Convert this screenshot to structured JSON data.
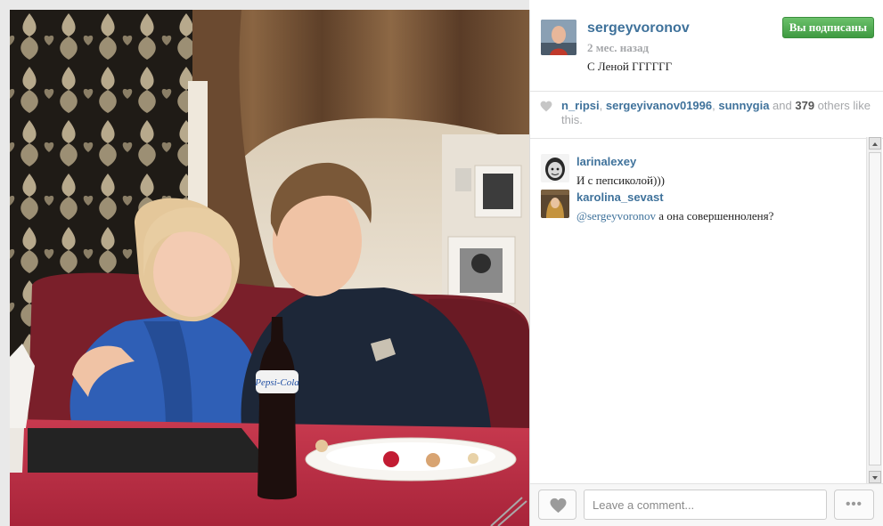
{
  "post": {
    "username": "sergeyvoronov",
    "time_ago": "2 мес. назад",
    "caption": "С Леной ГГГГГГ",
    "follow_label": "Вы подписаны",
    "photo_bottle_label": "Pepsi-Cola"
  },
  "likes": {
    "users": [
      "n_ripsi",
      "sergeyivanov01996",
      "sunnygia"
    ],
    "sep": ", ",
    "and_text": " and ",
    "others_count": "379",
    "others_text": " others like this."
  },
  "comments": [
    {
      "user": "larinalexey",
      "text": "И с пепсиколой)))"
    },
    {
      "user": "karolina_sevast",
      "mention": "@sergeyvoronov",
      "text": " а она совершенноленя?"
    }
  ],
  "comment_bar": {
    "placeholder": "Leave a comment...",
    "more_label": "•••"
  },
  "icons": {
    "like": "heart-icon",
    "more": "ellipsis-icon",
    "scroll_up": "arrow-up-icon",
    "scroll_down": "arrow-down-icon"
  },
  "colors": {
    "link": "#3f729b",
    "follow_button": "#4aa84c",
    "muted": "#a5a7aa"
  }
}
